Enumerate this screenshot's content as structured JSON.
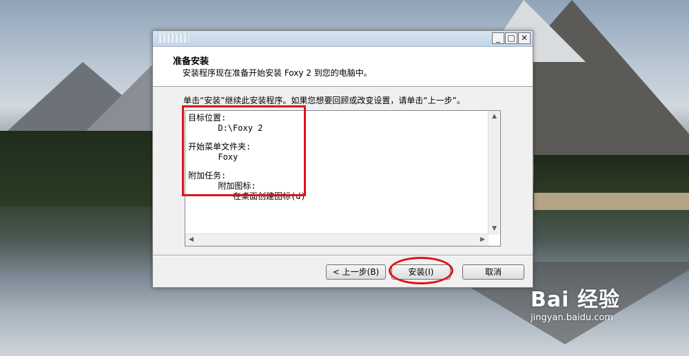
{
  "window": {
    "title_obscured": true,
    "min_glyph": "_",
    "max_glyph": "□",
    "close_glyph": "✕"
  },
  "header": {
    "title": "准备安装",
    "subtitle": "安装程序现在准备开始安装 Foxy 2 到您的电脑中。"
  },
  "instruction": "单击“安装”继续此安装程序。如果您想要回顾或改变设置，请单击“上一步”。",
  "summary": {
    "lines": [
      "目标位置:",
      "      D:\\Foxy 2",
      "",
      "开始菜单文件夹:",
      "      Foxy",
      "",
      "附加任务:",
      "      附加图标:",
      "         在桌面创建图标(d)"
    ]
  },
  "scroll": {
    "up": "▲",
    "down": "▼",
    "left": "◀",
    "right": "▶"
  },
  "buttons": {
    "back": "< 上一步(B)",
    "install": "安装(I)",
    "cancel": "取消"
  },
  "annotations": {
    "highlight_color": "#e0101a"
  },
  "watermark": {
    "logo": "Bai  经验",
    "url": "jingyan.baidu.com"
  }
}
